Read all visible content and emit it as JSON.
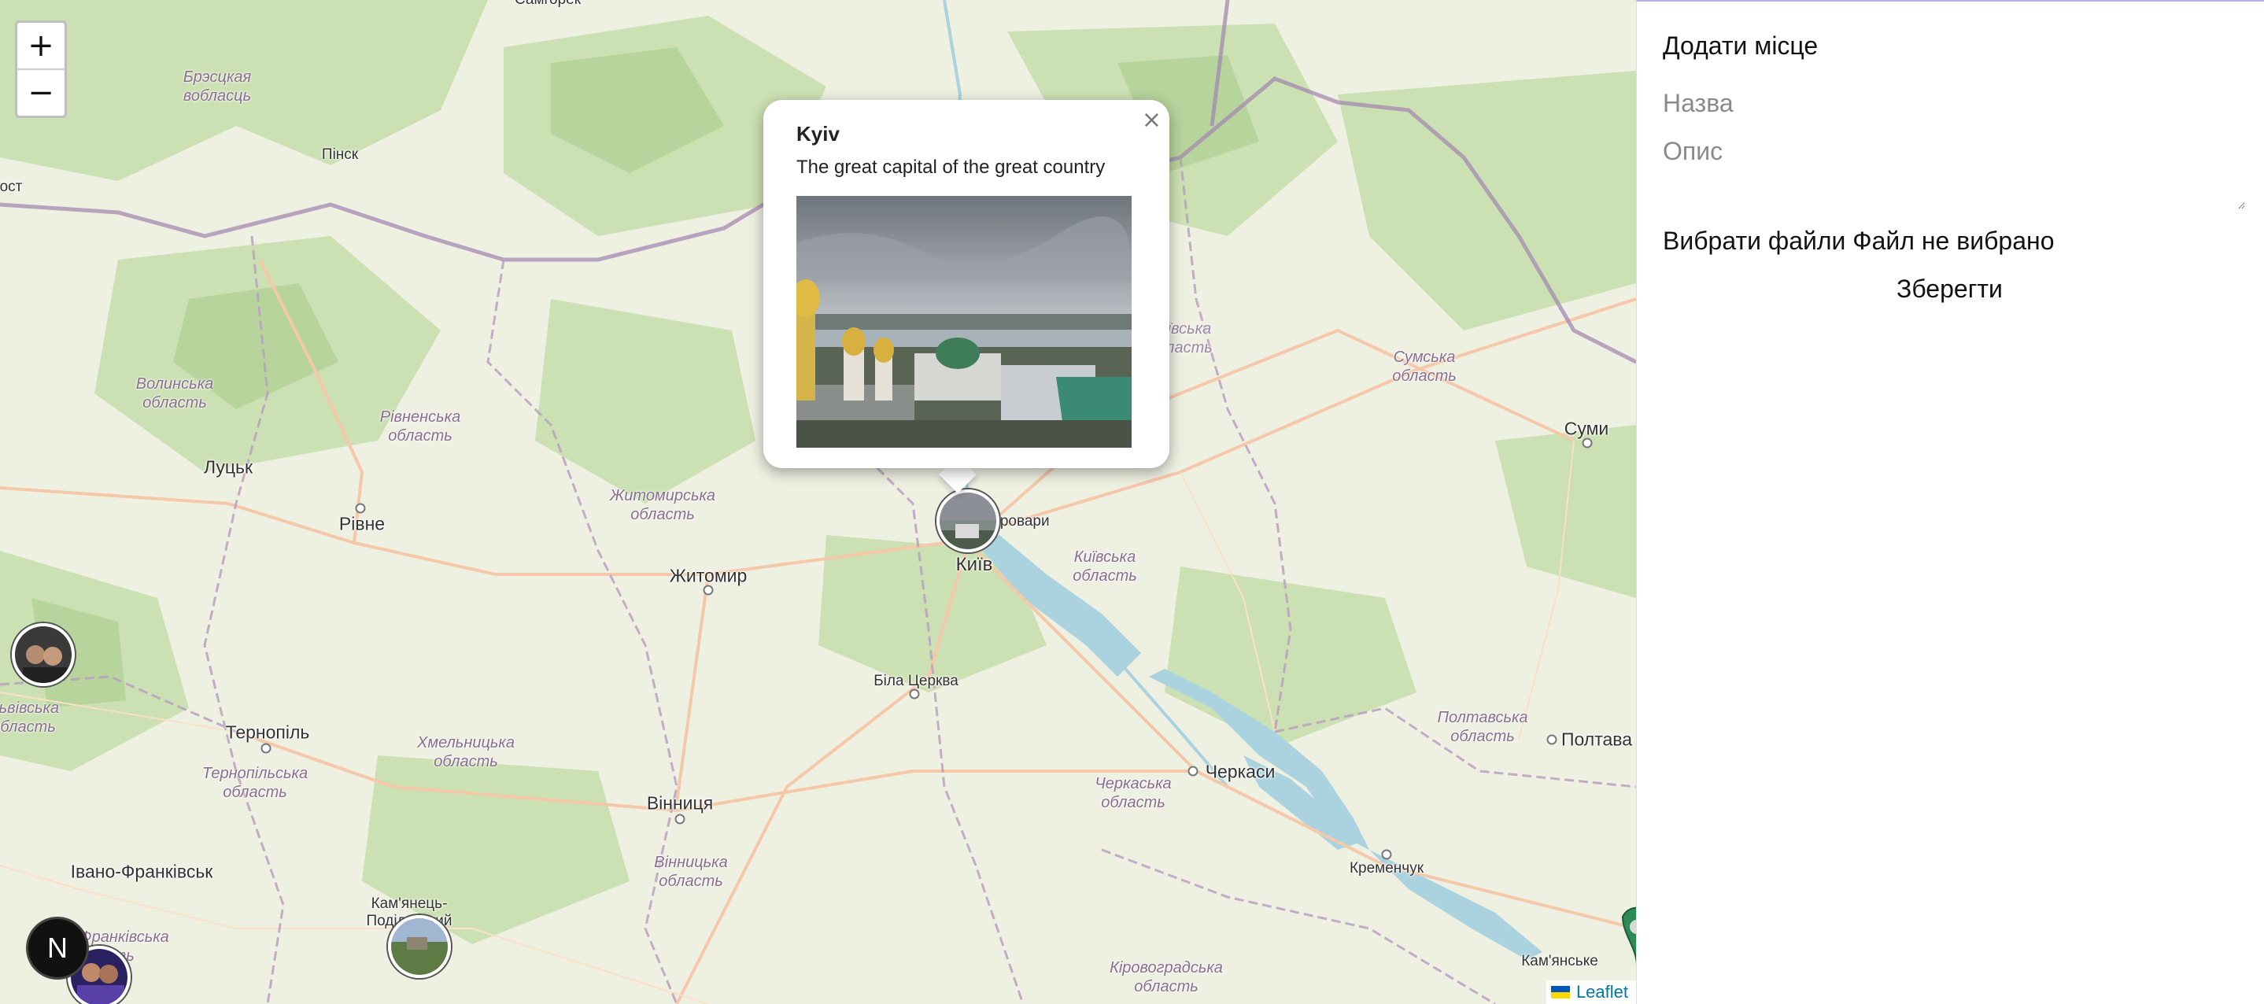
{
  "map": {
    "zoom_in_label": "+",
    "zoom_out_label": "−",
    "attribution": "Leaflet",
    "badge_letter": "N",
    "cities": [
      {
        "name": "Луцьк",
        "cls": "city"
      },
      {
        "name": "Рівне",
        "cls": "city"
      },
      {
        "name": "Житомир",
        "cls": "city"
      },
      {
        "name": "Київ",
        "cls": "city"
      },
      {
        "name": "Тернопіль",
        "cls": "city"
      },
      {
        "name": "Вінниця",
        "cls": "city"
      },
      {
        "name": "Черкаси",
        "cls": "city"
      },
      {
        "name": "Полтава",
        "cls": "city"
      },
      {
        "name": "Суми",
        "cls": "city"
      },
      {
        "name": "Івано-Франківськ",
        "cls": "city"
      },
      {
        "name": "Біла Церква",
        "cls": "town"
      },
      {
        "name": "Кременчук",
        "cls": "town"
      },
      {
        "name": "Кам'янське",
        "cls": "town"
      },
      {
        "name": "Пінск",
        "cls": "town"
      },
      {
        "name": "Кам'янець-Подільський",
        "cls": "town"
      },
      {
        "name": "Бровари",
        "cls": "town"
      },
      {
        "name": "Самгорек",
        "cls": "town"
      },
      {
        "name": "ост",
        "cls": "town"
      }
    ],
    "regions": [
      {
        "name": "Брэсцкая\nвобласць"
      },
      {
        "name": "Волинська\nобласть"
      },
      {
        "name": "Рівненська\nобласть"
      },
      {
        "name": "Житомирська\nобласть"
      },
      {
        "name": "Київська\nобласть"
      },
      {
        "name": "Сумська\nобласть"
      },
      {
        "name": "Хмельницька\nобласть"
      },
      {
        "name": "Тернопільська\nобласть"
      },
      {
        "name": "Вінницька\nобласть"
      },
      {
        "name": "Черкаська\nобласть"
      },
      {
        "name": "Полтавська\nобласть"
      },
      {
        "name": "Кіровоградська\nобласть"
      },
      {
        "name": "Львівська\nобласть"
      },
      {
        "name": "Івано-Франківська\nобласть"
      },
      {
        "name": "Київська\nобласть"
      }
    ],
    "popup": {
      "title": "Kyiv",
      "description": "The great capital of the great country",
      "close_glyph": "×"
    },
    "colors": {
      "land": "#eef0e2",
      "forest": "#c8dfae",
      "water": "#aad3df",
      "border": "#a48ab0",
      "road": "#f4c8a8"
    }
  },
  "panel": {
    "title": "Додати місце",
    "name_placeholder": "Назва",
    "description_placeholder": "Опис",
    "file_button": "Вибрати файли",
    "file_status": "Файл не вибрано",
    "save_label": "Зберегти"
  }
}
